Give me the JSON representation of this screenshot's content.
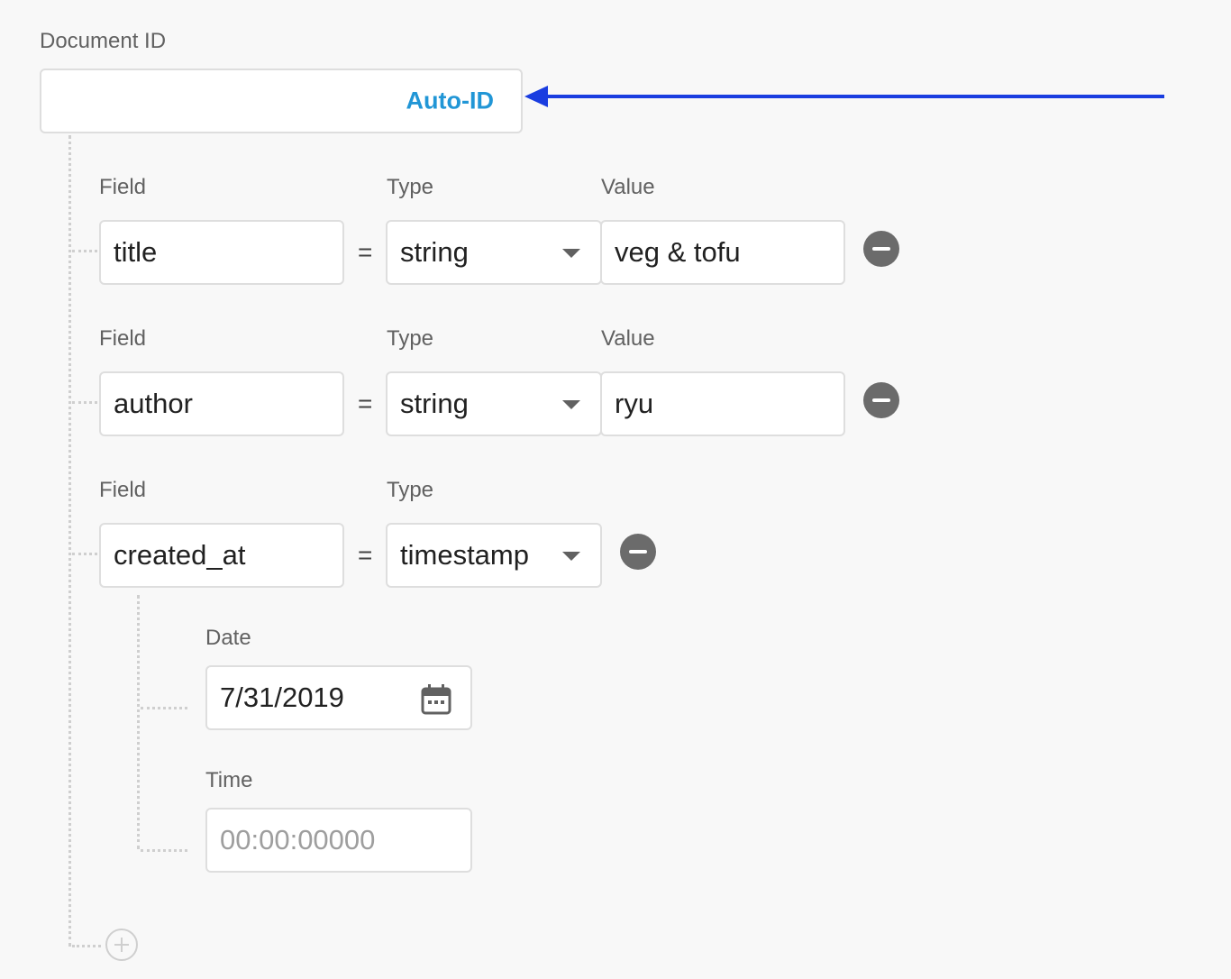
{
  "document_id": {
    "label": "Document ID",
    "auto_id_button": "Auto-ID",
    "value": ""
  },
  "accent_color": "#2196d6",
  "annotation_arrow_color": "#1a3de0",
  "fields": [
    {
      "field_label": "Field",
      "type_label": "Type",
      "value_label": "Value",
      "name": "title",
      "equals": "=",
      "type": "string",
      "value": "veg & tofu",
      "remove_icon": "minus-circle-icon"
    },
    {
      "field_label": "Field",
      "type_label": "Type",
      "value_label": "Value",
      "name": "author",
      "equals": "=",
      "type": "string",
      "value": "ryu",
      "remove_icon": "minus-circle-icon"
    },
    {
      "field_label": "Field",
      "type_label": "Type",
      "name": "created_at",
      "equals": "=",
      "type": "timestamp",
      "remove_icon": "minus-circle-icon",
      "timestamp": {
        "date_label": "Date",
        "date_value": "7/31/2019",
        "date_icon": "calendar-icon",
        "time_label": "Time",
        "time_value": "",
        "time_placeholder": "00:00:00000"
      }
    }
  ],
  "add_field_icon": "plus-circle-icon"
}
